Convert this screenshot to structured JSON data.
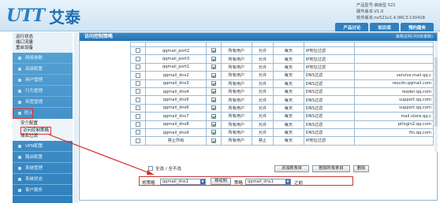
{
  "header": {
    "logo_mark": "UTT",
    "logo_text": "艾泰",
    "device_info": [
      "产品型号:高级型 521",
      "硬件版本:V1.0",
      "软件版本:nv521v1.4.0RC3-130418"
    ],
    "nav": [
      "产品讨论",
      "知识库",
      "预约服务"
    ]
  },
  "sidebar": {
    "top_items": [
      "运行状态",
      "端口流量",
      "重启设备"
    ],
    "groups": [
      "网络参数",
      "高级配置",
      "用户管理",
      "行为管理",
      "带宽管理"
    ],
    "highlighted_group": "防火墙",
    "sub_items": [
      "安全配置",
      "访问控制策略",
      "域名过滤"
    ],
    "groups_after": [
      "VPN配置",
      "路由配置",
      "系统管理",
      "系统状态",
      "客户服务"
    ]
  },
  "panel": {
    "title": "访问控制策略",
    "help": "策略说明(共6条策略)"
  },
  "table": {
    "rows": [
      [
        "qqmail_port2",
        "所有用户",
        "允许",
        "每天",
        "IP地址过滤",
        ""
      ],
      [
        "qqmail_port3",
        "所有用户",
        "允许",
        "每天",
        "IP地址过滤",
        ""
      ],
      [
        "qqmail_port1",
        "所有用户",
        "允许",
        "每天",
        "IP地址过滤",
        ""
      ],
      [
        "qqmail_dns2",
        "所有用户",
        "允许",
        "每天",
        "DNS过滤",
        "service.mail.qq.c"
      ],
      [
        "qqmail_dns3",
        "所有用户",
        "允许",
        "每天",
        "DNS过滤",
        "rescdn.qqmail.com"
      ],
      [
        "qqmail_dns4",
        "所有用户",
        "允许",
        "每天",
        "DNS过滤",
        "reader.qq.com"
      ],
      [
        "qqmail_dns5",
        "所有用户",
        "允许",
        "每天",
        "DNS过滤",
        "support.qq.com"
      ],
      [
        "qqmail_dns6",
        "所有用户",
        "允许",
        "每天",
        "DNS过滤",
        "support.qq.com"
      ],
      [
        "qqmail_dns7",
        "所有用户",
        "允许",
        "每天",
        "DNS过滤",
        "mail.store.qq.c"
      ],
      [
        "qqmail_dns8",
        "所有用户",
        "允许",
        "每天",
        "DNS过滤",
        "ptlogin2.qq.com"
      ],
      [
        "qqmail_dns9",
        "所有用户",
        "允许",
        "每天",
        "DNS过滤",
        "ftn.qq.com"
      ],
      [
        "禁止所有",
        "所有用户",
        "禁止",
        "每天",
        "IP地址过滤",
        ""
      ]
    ]
  },
  "actions": {
    "select_all": "全选 / 全不选",
    "add": "添加新条目",
    "delete_all": "删除所有条目",
    "delete": "删除"
  },
  "move": {
    "label_before": "将策略",
    "select1": "qqmail_dns1",
    "move_button": "移动到",
    "label_mid": "策略",
    "select2": "qqmail_dns1",
    "label_after": "之前"
  }
}
